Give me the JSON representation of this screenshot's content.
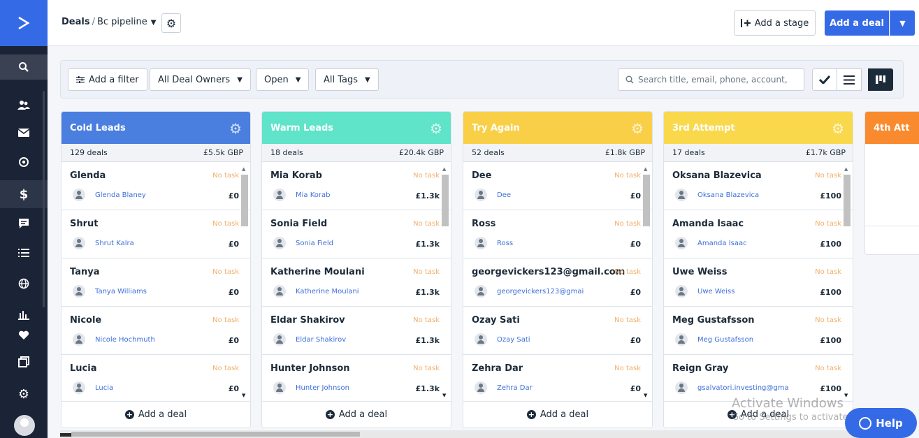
{
  "breadcrumb": {
    "section": "Deals",
    "separator": "/",
    "pipeline": "Bc pipeline"
  },
  "topbar": {
    "add_stage_label": "Add a stage",
    "add_deal_label": "Add a deal"
  },
  "filters": {
    "add_filter_label": "Add a filter",
    "owners_label": "All Deal Owners",
    "status_label": "Open",
    "tags_label": "All Tags",
    "search_placeholder": "Search title, email, phone, account,"
  },
  "columns": [
    {
      "title": "Cold Leads",
      "color": "#4a7fe0",
      "deal_count": "129 deals",
      "total": "£5.5k GBP",
      "footer": "Add a deal",
      "cards": [
        {
          "name": "Glenda",
          "task": "No task",
          "contact": "Glenda Blaney",
          "value": "£0"
        },
        {
          "name": "Shrut",
          "task": "No task",
          "contact": "Shrut Kalra",
          "value": "£0"
        },
        {
          "name": "Tanya",
          "task": "No task",
          "contact": "Tanya Williams",
          "value": "£0"
        },
        {
          "name": "Nicole",
          "task": "No task",
          "contact": "Nicole Hochmuth",
          "value": "£0"
        },
        {
          "name": "Lucia",
          "task": "No task",
          "contact": "Lucia",
          "value": "£0"
        }
      ]
    },
    {
      "title": "Warm Leads",
      "color": "#5fe3c9",
      "deal_count": "18 deals",
      "total": "£20.4k GBP",
      "footer": "Add a deal",
      "cards": [
        {
          "name": "Mia Korab",
          "task": "No task",
          "contact": "Mia Korab",
          "value": "£1.3k"
        },
        {
          "name": "Sonia Field",
          "task": "No task",
          "contact": "Sonia Field",
          "value": "£1.3k"
        },
        {
          "name": "Katherine Moulani",
          "task": "No task",
          "contact": "Katherine Moulani",
          "value": "£1.3k"
        },
        {
          "name": "Eldar Shakirov",
          "task": "No task",
          "contact": "Eldar Shakirov",
          "value": "£1.3k"
        },
        {
          "name": "Hunter Johnson",
          "task": "No task",
          "contact": "Hunter Johnson",
          "value": "£1.3k"
        }
      ]
    },
    {
      "title": "Try Again",
      "color": "#f9cf47",
      "deal_count": "52 deals",
      "total": "£1.8k GBP",
      "footer": "Add a deal",
      "cards": [
        {
          "name": "Dee",
          "task": "No task",
          "contact": "Dee",
          "value": "£0"
        },
        {
          "name": "Ross",
          "task": "No task",
          "contact": "Ross",
          "value": "£0"
        },
        {
          "name": "georgevickers123@gmail.com",
          "task": "No task",
          "contact": "georgevickers123@gmai",
          "value": "£0"
        },
        {
          "name": "Ozay Sati",
          "task": "No task",
          "contact": "Ozay Sati",
          "value": "£0"
        },
        {
          "name": "Zehra Dar",
          "task": "No task",
          "contact": "Zehra Dar",
          "value": "£0"
        }
      ]
    },
    {
      "title": "3rd Attempt",
      "color": "#f9d84c",
      "deal_count": "17 deals",
      "total": "£1.7k GBP",
      "footer": "Add a deal",
      "cards": [
        {
          "name": "Oksana Blazevica",
          "task": "No task",
          "contact": "Oksana Blazevica",
          "value": "£100"
        },
        {
          "name": "Amanda Isaac",
          "task": "No task",
          "contact": "Amanda Isaac",
          "value": "£100"
        },
        {
          "name": "Uwe Weiss",
          "task": "No task",
          "contact": "Uwe Weiss",
          "value": "£100"
        },
        {
          "name": "Meg Gustafsson",
          "task": "No task",
          "contact": "Meg Gustafsson",
          "value": "£100"
        },
        {
          "name": "Reign Gray",
          "task": "No task",
          "contact": "gsalvatori.investing@gma",
          "value": "£100"
        }
      ]
    }
  ],
  "partial_column": {
    "title": "4th Att",
    "color": "#fa8a2e"
  },
  "watermark": {
    "line1": "Activate Windows",
    "line2": "Go to Settings to activate Windows."
  },
  "help_label": "Help"
}
